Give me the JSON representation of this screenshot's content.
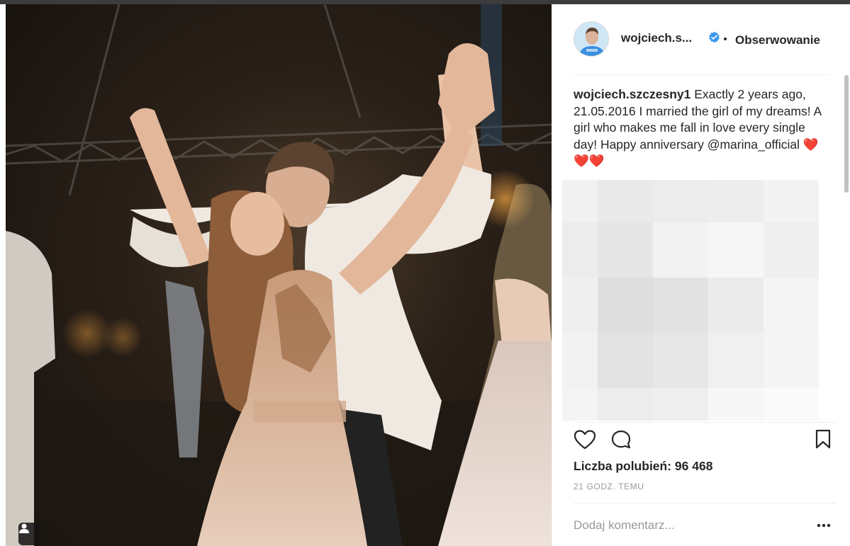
{
  "post": {
    "username": "wojciech.s...",
    "follow_status": "Obserwowanie",
    "caption_username": "wojciech.szczesny1",
    "caption_text": " Exactly 2 years ago, 21.05.2016 I married the girl of my dreams! A girl who makes me fall in love every single day! Happy anniversary @marina_official ",
    "caption_emoji": "❤️❤️❤️",
    "likes": "Liczba polubień: 96 468",
    "timestamp": "21 GODZ. TEMU",
    "comment_placeholder": "Dodaj komentarz..."
  },
  "icons": {
    "verified": "verified-badge-icon",
    "like": "heart-outline-icon",
    "comment": "comment-bubble-icon",
    "save": "bookmark-outline-icon",
    "more": "ellipsis-icon",
    "tagged": "user-tag-icon"
  },
  "colors": {
    "verified_blue": "#3897f0",
    "text": "#262626",
    "muted": "#999999",
    "heart_red": "#e0245e"
  }
}
